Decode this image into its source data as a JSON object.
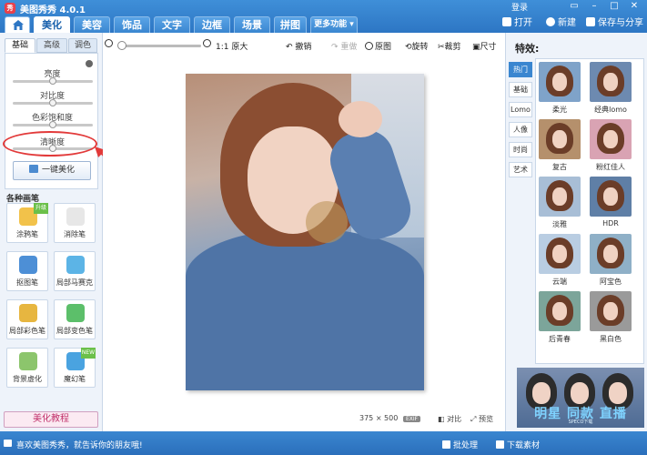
{
  "app": {
    "title": "美图秀秀 4.0.1",
    "logo_text": "秀",
    "login": "登录"
  },
  "tabs": [
    "美化",
    "美容",
    "饰品",
    "文字",
    "边框",
    "场景",
    "拼图",
    "更多功能 ▾"
  ],
  "actions": {
    "open": "打开",
    "new": "新建",
    "save_share": "保存与分享"
  },
  "left": {
    "sub_tabs": [
      "基础",
      "高级",
      "调色"
    ],
    "sliders": [
      {
        "label": "亮度",
        "value": 0.5
      },
      {
        "label": "对比度",
        "value": 0.5
      },
      {
        "label": "色彩饱和度",
        "value": 0.5
      },
      {
        "label": "清晰度",
        "value": 0.5
      }
    ],
    "one_click": "一键美化",
    "brush_heading": "各种画笔",
    "brushes": [
      {
        "label": "涂鸦笔",
        "badge": "升级",
        "color": "#f2c24a"
      },
      {
        "label": "消除笔",
        "badge": "",
        "color": "#e7e7e7"
      },
      {
        "label": "抠图笔",
        "badge": "",
        "color": "#4d8fd6"
      },
      {
        "label": "局部马赛克",
        "badge": "",
        "color": "#5cb4e6"
      },
      {
        "label": "局部彩色笔",
        "badge": "",
        "color": "#e7b640"
      },
      {
        "label": "局部变色笔",
        "badge": "",
        "color": "#5cbf6a"
      },
      {
        "label": "背景虚化",
        "badge": "",
        "color": "#8cc56c"
      },
      {
        "label": "魔幻笔",
        "badge": "NEW",
        "color": "#4aa3e0"
      }
    ],
    "tutorial": "美化教程"
  },
  "toolbar": {
    "zoom_level": 0.0,
    "ratio": "1:1 原大",
    "undo": "撤销",
    "redo": "重做",
    "original": "原图",
    "rotate": "旋转",
    "crop": "裁剪",
    "size": "尺寸"
  },
  "canvas": {
    "dims": "375 × 500",
    "exif": "EXIF",
    "compare": "对比",
    "preview": "预览"
  },
  "effects": {
    "title": "特效:",
    "categories": [
      "热门",
      "基础",
      "Lomo",
      "人像",
      "时尚",
      "艺术"
    ],
    "items": [
      {
        "label": "柔光",
        "tint": "#7fa3c9"
      },
      {
        "label": "经典lomo",
        "tint": "#6d8ab0"
      },
      {
        "label": "复古",
        "tint": "#b5906c"
      },
      {
        "label": "粉红佳人",
        "tint": "#d9a3b3"
      },
      {
        "label": "淡雅",
        "tint": "#a8bed6"
      },
      {
        "label": "HDR",
        "tint": "#5f7fa6"
      },
      {
        "label": "云端",
        "tint": "#b9cde2"
      },
      {
        "label": "阿宝色",
        "tint": "#8fb0c7"
      },
      {
        "label": "后青春",
        "tint": "#7ca59a"
      },
      {
        "label": "黑白色",
        "tint": "#9a9a9a"
      }
    ],
    "ad_text": "明星  同款  直播",
    "ad_watermark": "SPECO下载"
  },
  "status": {
    "message": "喜欢美图秀秀，就告诉你的朋友哦!",
    "batch": "批处理",
    "downloads": "下载素材"
  }
}
